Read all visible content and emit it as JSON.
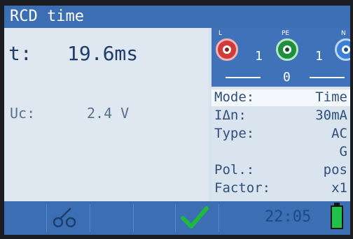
{
  "title": "RCD time",
  "result": {
    "label": "t:",
    "value": "19.6ms"
  },
  "uc": {
    "label": "Uc:",
    "value": "2.4 V"
  },
  "terminals": {
    "labels": [
      "L",
      "PE",
      "N"
    ],
    "l_pe": "1",
    "pe_n": "1",
    "l_n": "0",
    "colors": {
      "L": "#d23a3a",
      "PE": "#1f8f3f",
      "N": "#3a7ed8"
    }
  },
  "params": [
    {
      "key": "Mode:",
      "value": "Time"
    },
    {
      "key": "IΔn:",
      "value": "30mA"
    },
    {
      "key": "Type:",
      "value": "AC"
    },
    {
      "key": "",
      "value": "G"
    },
    {
      "key": "Pol.:",
      "value": "pos"
    },
    {
      "key": "Factor:",
      "value": "x1"
    }
  ],
  "footer": {
    "probe_icon": "probe-connect-icon",
    "status_icon": "checkmark-icon",
    "clock": "22:05",
    "battery_icon": "battery-icon",
    "battery_level": 1.0
  }
}
